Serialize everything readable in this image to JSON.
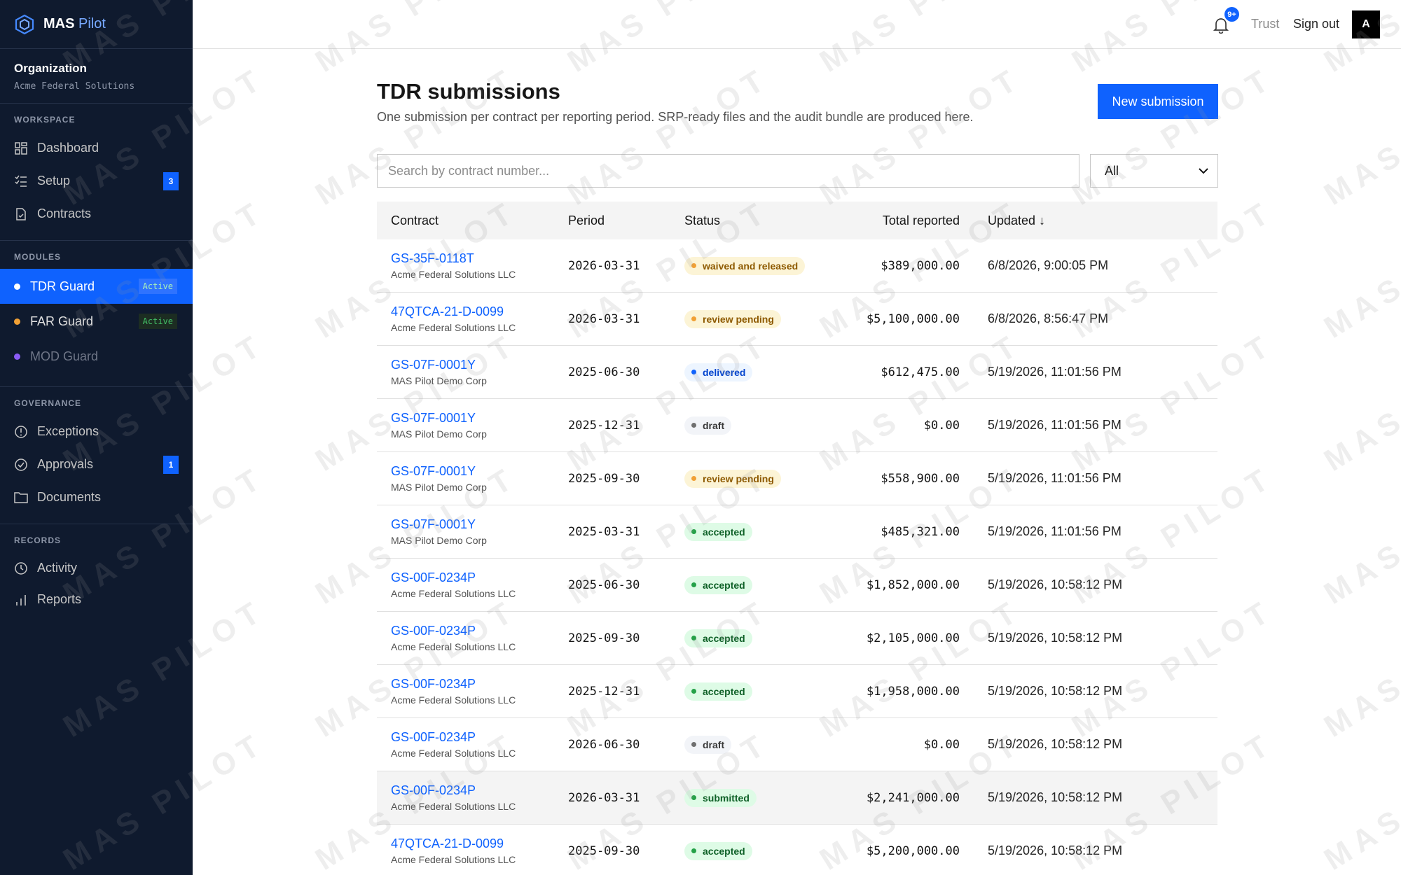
{
  "brand": {
    "name_part1": "MAS",
    "name_part2": "Pilot"
  },
  "organization": {
    "label": "Organization",
    "value": "Acme Federal Solutions"
  },
  "workspace": {
    "title": "WORKSPACE",
    "items": [
      {
        "label": "Dashboard",
        "icon": "grid-icon"
      },
      {
        "label": "Setup",
        "icon": "checklist-icon",
        "badge": "3"
      },
      {
        "label": "Contracts",
        "icon": "document-icon"
      }
    ]
  },
  "modules": {
    "title": "MODULES",
    "items": [
      {
        "label": "TDR Guard",
        "tag": "Active",
        "dot_color": "#ffffff"
      },
      {
        "label": "FAR Guard",
        "tag": "Active",
        "dot_color": "#f1a035"
      },
      {
        "label": "MOD Guard",
        "dot_color": "#8a5cf6"
      }
    ]
  },
  "governance": {
    "title": "GOVERNANCE",
    "items": [
      {
        "label": "Exceptions",
        "icon": "alert-circle-icon"
      },
      {
        "label": "Approvals",
        "icon": "check-circle-icon",
        "badge": "1"
      },
      {
        "label": "Documents",
        "icon": "folder-icon"
      }
    ]
  },
  "records": {
    "title": "RECORDS",
    "items": [
      {
        "label": "Activity",
        "icon": "clock-icon"
      },
      {
        "label": "Reports",
        "icon": "bar-chart-icon"
      }
    ]
  },
  "topbar": {
    "notification_badge": "9+",
    "trust": "Trust",
    "sign_out": "Sign out",
    "avatar": "A"
  },
  "page": {
    "title": "TDR submissions",
    "subtitle": "One submission per contract per reporting period. SRP-ready files and the audit bundle are produced here.",
    "new_button": "New submission",
    "search_placeholder": "Search by contract number...",
    "filter_value": "All"
  },
  "table": {
    "headers": {
      "contract": "Contract",
      "period": "Period",
      "status": "Status",
      "total": "Total reported",
      "updated": "Updated",
      "sort_indicator": "↓"
    },
    "rows": [
      {
        "contract": "GS-35F-0118T",
        "company": "Acme Federal Solutions LLC",
        "period": "2026-03-31",
        "status": "waived and released",
        "total": "$389,000.00",
        "updated": "6/8/2026, 9:00:05 PM"
      },
      {
        "contract": "47QTCA-21-D-0099",
        "company": "Acme Federal Solutions LLC",
        "period": "2026-03-31",
        "status": "review pending",
        "total": "$5,100,000.00",
        "updated": "6/8/2026, 8:56:47 PM"
      },
      {
        "contract": "GS-07F-0001Y",
        "company": "MAS Pilot Demo Corp",
        "period": "2025-06-30",
        "status": "delivered",
        "total": "$612,475.00",
        "updated": "5/19/2026, 11:01:56 PM"
      },
      {
        "contract": "GS-07F-0001Y",
        "company": "MAS Pilot Demo Corp",
        "period": "2025-12-31",
        "status": "draft",
        "total": "$0.00",
        "updated": "5/19/2026, 11:01:56 PM"
      },
      {
        "contract": "GS-07F-0001Y",
        "company": "MAS Pilot Demo Corp",
        "period": "2025-09-30",
        "status": "review pending",
        "total": "$558,900.00",
        "updated": "5/19/2026, 11:01:56 PM"
      },
      {
        "contract": "GS-07F-0001Y",
        "company": "MAS Pilot Demo Corp",
        "period": "2025-03-31",
        "status": "accepted",
        "total": "$485,321.00",
        "updated": "5/19/2026, 11:01:56 PM"
      },
      {
        "contract": "GS-00F-0234P",
        "company": "Acme Federal Solutions LLC",
        "period": "2025-06-30",
        "status": "accepted",
        "total": "$1,852,000.00",
        "updated": "5/19/2026, 10:58:12 PM"
      },
      {
        "contract": "GS-00F-0234P",
        "company": "Acme Federal Solutions LLC",
        "period": "2025-09-30",
        "status": "accepted",
        "total": "$2,105,000.00",
        "updated": "5/19/2026, 10:58:12 PM"
      },
      {
        "contract": "GS-00F-0234P",
        "company": "Acme Federal Solutions LLC",
        "period": "2025-12-31",
        "status": "accepted",
        "total": "$1,958,000.00",
        "updated": "5/19/2026, 10:58:12 PM"
      },
      {
        "contract": "GS-00F-0234P",
        "company": "Acme Federal Solutions LLC",
        "period": "2026-06-30",
        "status": "draft",
        "total": "$0.00",
        "updated": "5/19/2026, 10:58:12 PM"
      },
      {
        "contract": "GS-00F-0234P",
        "company": "Acme Federal Solutions LLC",
        "period": "2026-03-31",
        "status": "submitted",
        "total": "$2,241,000.00",
        "updated": "5/19/2026, 10:58:12 PM",
        "highlighted": true
      },
      {
        "contract": "47QTCA-21-D-0099",
        "company": "Acme Federal Solutions LLC",
        "period": "2025-09-30",
        "status": "accepted",
        "total": "$5,200,000.00",
        "updated": "5/19/2026, 10:58:12 PM"
      }
    ]
  },
  "status_colors": {
    "waived and released": {
      "bg": "#fcf4d6",
      "fg": "#8e5a00",
      "dot": "#f1a035"
    },
    "review pending": {
      "bg": "#fcf4d6",
      "fg": "#8e5a00",
      "dot": "#f1a035"
    },
    "delivered": {
      "bg": "#edf5ff",
      "fg": "#0043ce",
      "dot": "#0f62fe"
    },
    "draft": {
      "bg": "#f2f4f8",
      "fg": "#393939",
      "dot": "#6f6f6f"
    },
    "accepted": {
      "bg": "#defbe6",
      "fg": "#0e6027",
      "dot": "#24a148"
    },
    "submitted": {
      "bg": "#defbe6",
      "fg": "#0e6027",
      "dot": "#24a148"
    }
  },
  "watermark": "MAS PILOT",
  "colors": {
    "accent": "#0f62fe",
    "sidebar_bg": "#0f1a2e"
  }
}
